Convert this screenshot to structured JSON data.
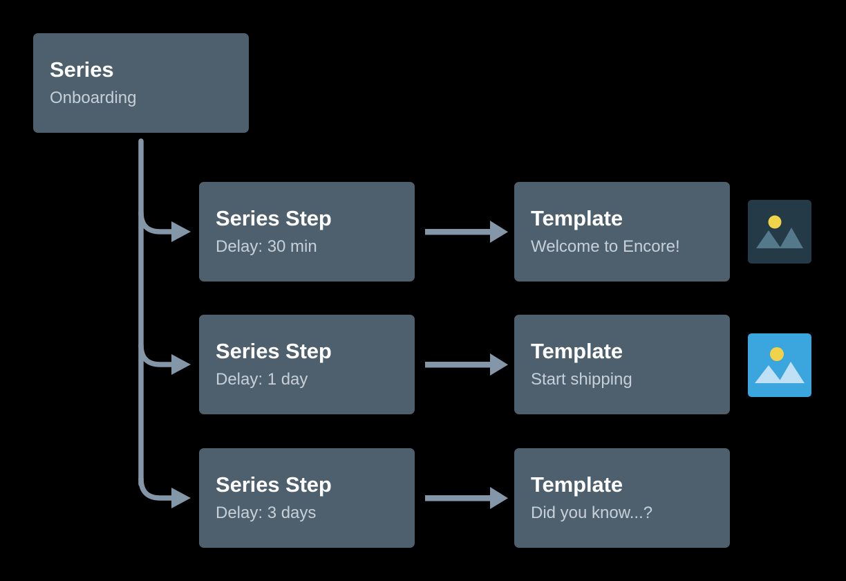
{
  "theme": {
    "page_background": "#000000",
    "card_background": "#4e606e",
    "title_color": "#ffffff",
    "subtitle_color": "#c7d0d8",
    "connector_color": "#8497a8",
    "thumb_inactive_background": "#243b47",
    "thumb_inactive_shape": "#53798a",
    "thumb_active_background": "#3aa6dd",
    "thumb_active_shape": "#bfe0f5",
    "thumb_sun": "#f0d24b"
  },
  "diagram": {
    "root": {
      "title": "Series",
      "subtitle": "Onboarding"
    },
    "rows": [
      {
        "step": {
          "title": "Series Step",
          "subtitle": "Delay: 30 min"
        },
        "template": {
          "title": "Template",
          "subtitle": "Welcome to Encore!"
        },
        "thumbnail": {
          "present": true,
          "state": "inactive",
          "icon": "image-placeholder-icon"
        }
      },
      {
        "step": {
          "title": "Series Step",
          "subtitle": "Delay: 1 day"
        },
        "template": {
          "title": "Template",
          "subtitle": "Start shipping"
        },
        "thumbnail": {
          "present": true,
          "state": "active",
          "icon": "image-placeholder-icon"
        }
      },
      {
        "step": {
          "title": "Series Step",
          "subtitle": "Delay: 3 days"
        },
        "template": {
          "title": "Template",
          "subtitle": "Did you know...?"
        },
        "thumbnail": {
          "present": false,
          "state": "none",
          "icon": ""
        }
      }
    ],
    "connectors": {
      "branch_icon": "arrow-right-icon",
      "link_icon": "arrow-right-icon"
    }
  }
}
